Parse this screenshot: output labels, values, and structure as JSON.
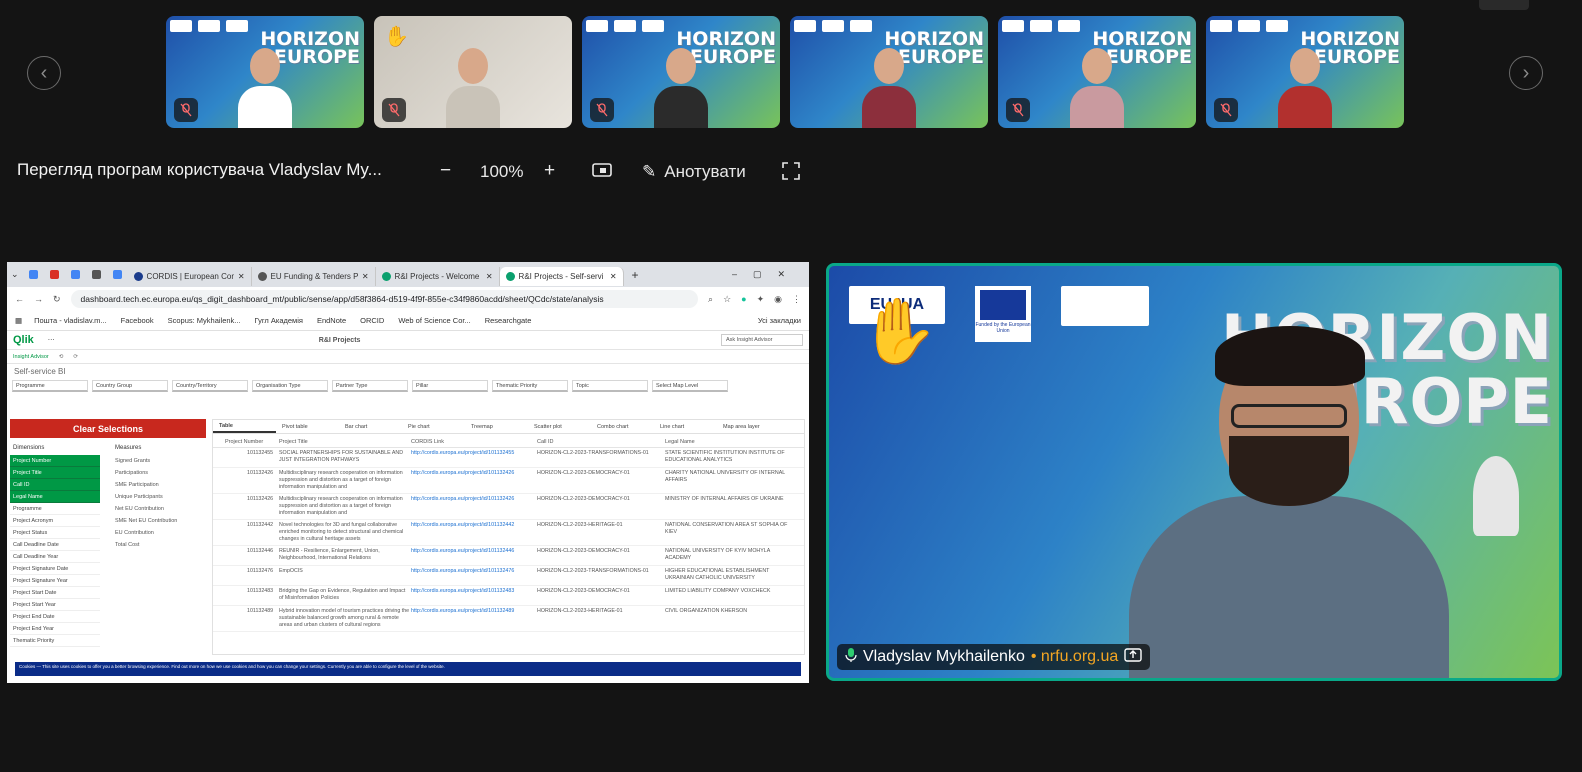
{
  "gallery": {
    "tiles": [
      {
        "banner": "HORIZON EUROPE",
        "shirt": "#ffffff",
        "muted": true
      },
      {
        "banner": "",
        "shirt": "#c9c3b8",
        "muted": true,
        "raised_hand": true
      },
      {
        "banner": "HORIZON EUROPE",
        "shirt": "#2b2b2b",
        "muted": true
      },
      {
        "banner": "HORIZON EUROPE",
        "shirt": "#8c2f3c",
        "muted": false
      },
      {
        "banner": "HORIZON EUROPE",
        "shirt": "#c99a9f",
        "muted": true
      },
      {
        "banner": "HORIZON EUROPE",
        "shirt": "#b2302e",
        "muted": true
      }
    ]
  },
  "toolbar": {
    "share_title": "Перегляд програм користувача Vladyslav My...",
    "zoom_out": "−",
    "zoom_value": "100%",
    "zoom_in": "+",
    "annotate_label": "Анотувати"
  },
  "browser": {
    "tabs": [
      "CORDIS | European Com",
      "EU Funding & Tenders P",
      "R&I Projects - Welcome",
      "R&I Projects - Self-servi"
    ],
    "url": "dashboard.tech.ec.europa.eu/qs_digit_dashboard_mt/public/sense/app/d58f3864-d519-4f9f-855e-c34f9860acdd/sheet/QCdc/state/analysis",
    "bookmarks": [
      "Пошта - vladislav.m...",
      "Facebook",
      "Scopus: Mykhailenk...",
      "Гугл Академія",
      "EndNote",
      "ORCID",
      "Web of Science Cor...",
      "Researchgate"
    ],
    "other_bookmarks": "Усі закладки"
  },
  "qlik": {
    "logo": "Qlik",
    "app_title": "R&I Projects",
    "search_placeholder": "Ask Insight Advisor",
    "insight_label": "Insight Advisor",
    "sheet_title": "Self-service BI",
    "filters": [
      "Programme",
      "Country Group",
      "Country/Territory",
      "Organisation Type",
      "Partner Type",
      "Pillar",
      "Thematic Priority",
      "Topic",
      "Select Map Level"
    ],
    "clear_label": "Clear Selections",
    "dimensions_label": "Dimensions",
    "measures_label": "Measures",
    "dimensions": [
      {
        "label": "Project Number",
        "selected": true
      },
      {
        "label": "Project Title",
        "selected": true
      },
      {
        "label": "Call ID",
        "selected": true
      },
      {
        "label": "Legal Name",
        "selected": true
      },
      {
        "label": "Programme",
        "selected": false
      },
      {
        "label": "Project Acronym",
        "selected": false
      },
      {
        "label": "Project Status",
        "selected": false
      },
      {
        "label": "Call Deadline Date",
        "selected": false
      },
      {
        "label": "Call Deadline Year",
        "selected": false
      },
      {
        "label": "Project Signature Date",
        "selected": false
      },
      {
        "label": "Project Signature Year",
        "selected": false
      },
      {
        "label": "Project Start Date",
        "selected": false
      },
      {
        "label": "Project Start Year",
        "selected": false
      },
      {
        "label": "Project End Date",
        "selected": false
      },
      {
        "label": "Project End Year",
        "selected": false
      },
      {
        "label": "Thematic Priority",
        "selected": false
      }
    ],
    "measures": [
      "Signed Grants",
      "Participations",
      "SME Participation",
      "Unique Participants",
      "Net EU Contribution",
      "SME Net EU Contribution",
      "EU Contribution",
      "Total Cost"
    ],
    "viz_tabs": [
      "Table",
      "Pivot table",
      "Bar chart",
      "Pie chart",
      "Treemap",
      "Scatter plot",
      "Combo chart",
      "Line chart",
      "Map area layer"
    ],
    "columns": [
      "Project Number",
      "Project Title",
      "CORDIS Link",
      "Call ID",
      "Legal Name"
    ],
    "rows": [
      [
        "101132455",
        "SOCIAL PARTNERSHIPS FOR SUSTAINABLE AND JUST INTEGRATION PATHWAYS",
        "http://cordis.europa.eu/project/id/101132455",
        "HORIZON-CL2-2023-TRANSFORMATIONS-01",
        "STATE SCIENTIFIC INSTITUTION INSTITUTE OF EDUCATIONAL ANALYTICS"
      ],
      [
        "101132426",
        "Multidisciplinary research cooperation on information suppression and distortion as a target of foreign information manipulation and",
        "http://cordis.europa.eu/project/id/101132426",
        "HORIZON-CL2-2023-DEMOCRACY-01",
        "CHARITY NATIONAL UNIVERSITY OF INTERNAL AFFAIRS"
      ],
      [
        "101132426",
        "Multidisciplinary research cooperation on information suppression and distortion as a target of foreign information manipulation and",
        "http://cordis.europa.eu/project/id/101132426",
        "HORIZON-CL2-2023-DEMOCRACY-01",
        "MINISTRY OF INTERNAL AFFAIRS OF UKRAINE"
      ],
      [
        "101132442",
        "Novel technologies for 3D and fungal collaborative enriched monitoring to detect structural and chemical changes in cultural heritage assets",
        "http://cordis.europa.eu/project/id/101132442",
        "HORIZON-CL2-2023-HERITAGE-01",
        "NATIONAL CONSERVATION AREA ST SOPHIA OF KIEV"
      ],
      [
        "101132446",
        "REUNIR - Resilience, Enlargement, Union, Neighbourhood, International Relations",
        "http://cordis.europa.eu/project/id/101132446",
        "HORIZON-CL2-2023-DEMOCRACY-01",
        "NATIONAL UNIVERSITY OF KYIV MOHYLA ACADEMY"
      ],
      [
        "101132476",
        "EmpOCIS",
        "http://cordis.europa.eu/project/id/101132476",
        "HORIZON-CL2-2023-TRANSFORMATIONS-01",
        "HIGHER EDUCATIONAL ESTABLISHMENT UKRAINIAN CATHOLIC UNIVERSITY"
      ],
      [
        "101132483",
        "Bridging the Gap on Evidence, Regulation and Impact of Misinformation Policies",
        "http://cordis.europa.eu/project/id/101132483",
        "HORIZON-CL2-2023-DEMOCRACY-01",
        "LIMITED LIABILITY COMPANY VOXCHECK"
      ],
      [
        "101132489",
        "Hybrid innovation model of tourism practices driving the sustainable balanced growth among rural & remote areas and urban clusters of cultural regions",
        "http://cordis.europa.eu/project/id/101132489",
        "HORIZON-CL2-2023-HERITAGE-01",
        "CIVIL ORGANIZATION KHERSON"
      ]
    ],
    "cookie_text": "Cookies — This site uses cookies to offer you a better browsing experience. Find out more on how we use cookies and how you can change your settings. Currently you are able to configure the level of the website."
  },
  "speaker": {
    "name": "Vladyslav Mykhailenko",
    "org": "nrfu.org.ua",
    "banner": "HORIZON EUROPE",
    "logo_left": "EU4UA",
    "eu_caption": "Funded by the European Union",
    "border_color": "#0aa889"
  }
}
